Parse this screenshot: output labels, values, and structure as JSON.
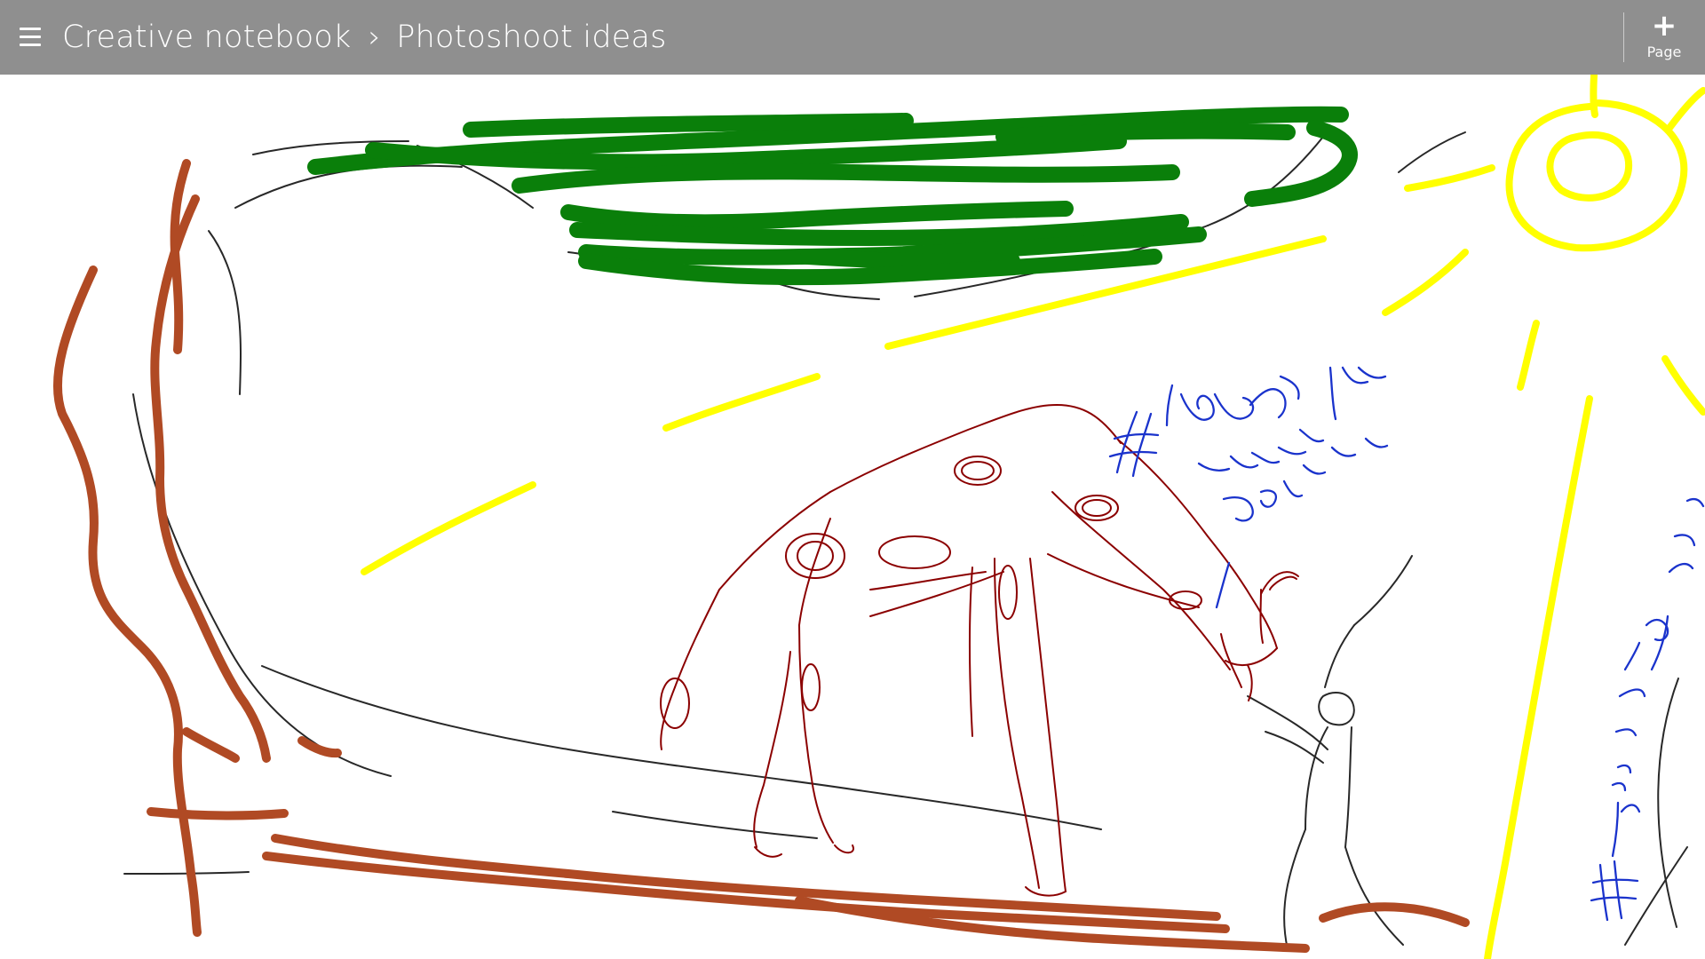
{
  "app": {
    "window_title": "Creative notebook › Photoshoot ideas"
  },
  "header": {
    "notebook": "Creative notebook",
    "separator": "›",
    "page_title": "Photoshoot ideas",
    "menu_icon": "hamburger-icon",
    "add_page": {
      "icon": "plus-icon",
      "label": "Page"
    }
  },
  "canvas": {
    "annotations": [
      {
        "text": "# lighting checked for giraffe",
        "color": "#1a33cc"
      },
      {
        "text": "# fill ~ 1/3 of model",
        "color": "#1a33cc"
      }
    ],
    "ink_colors": {
      "tree_trunk": "#b04a24",
      "foliage": "#0a8a0a",
      "sun": "#ffff00",
      "giraffe": "#8b0000",
      "sketch": "#111111",
      "notes": "#1a33cc"
    }
  },
  "colors": {
    "topbar": "#8f8f8f",
    "topbar_text": "#ffffff",
    "canvas": "#ffffff"
  }
}
